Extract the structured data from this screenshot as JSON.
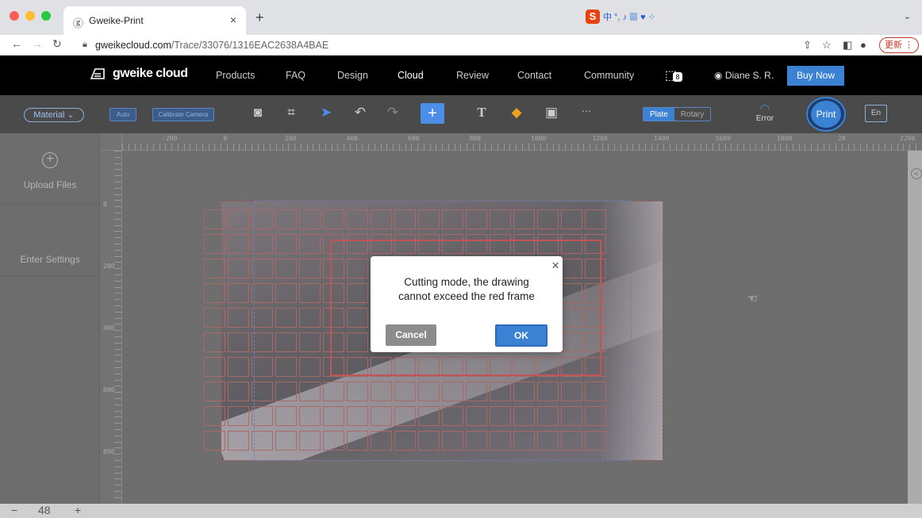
{
  "browser": {
    "tab_title": "Gweike-Print",
    "tab_close": "×",
    "new_tab": "+",
    "tab_menu": "⌄",
    "url_host": "gweikecloud.com",
    "url_path": "/Trace/33076/1316EAC2638A4BAE",
    "update_label": "更新 ⋮",
    "ime_label": "中 °, ♪ ▦ ♥ ⁘"
  },
  "site_nav": {
    "logo": "gweike cloud",
    "items": [
      "Products",
      "FAQ",
      "Design",
      "Cloud",
      "Review",
      "Contact",
      "Community"
    ],
    "active": "Cloud",
    "cart_count": "8",
    "user": "Diane S. R.",
    "buy_now": "Buy Now"
  },
  "toolbar": {
    "material": "Material",
    "auto": "Auto",
    "calibrate": "Calibrate Camera",
    "plate": "Plate",
    "rotary": "Rotary",
    "wifi_status": "Error",
    "print": "Print",
    "lang": "En",
    "more": "···",
    "text_tool": "T"
  },
  "sidebar": {
    "upload": "Upload Files",
    "settings": "Enter Settings"
  },
  "ruler": {
    "h_labels": [
      "-200",
      "0",
      "200",
      "400",
      "600",
      "800",
      "1000",
      "1200",
      "1400",
      "1600",
      "1800",
      "2K",
      "2200"
    ],
    "v_labels": [
      "0",
      "200",
      "400",
      "600",
      "800"
    ]
  },
  "dialog": {
    "message_line1": "Cutting mode, the drawing",
    "message_line2": "cannot exceed the red frame",
    "cancel": "Cancel",
    "ok": "OK",
    "close": "×"
  },
  "zoom": {
    "minus": "−",
    "value": "48",
    "plus": "+"
  },
  "colors": {
    "accent": "#3b82d4",
    "red_frame": "#e32020",
    "nav_bg": "#000000"
  }
}
